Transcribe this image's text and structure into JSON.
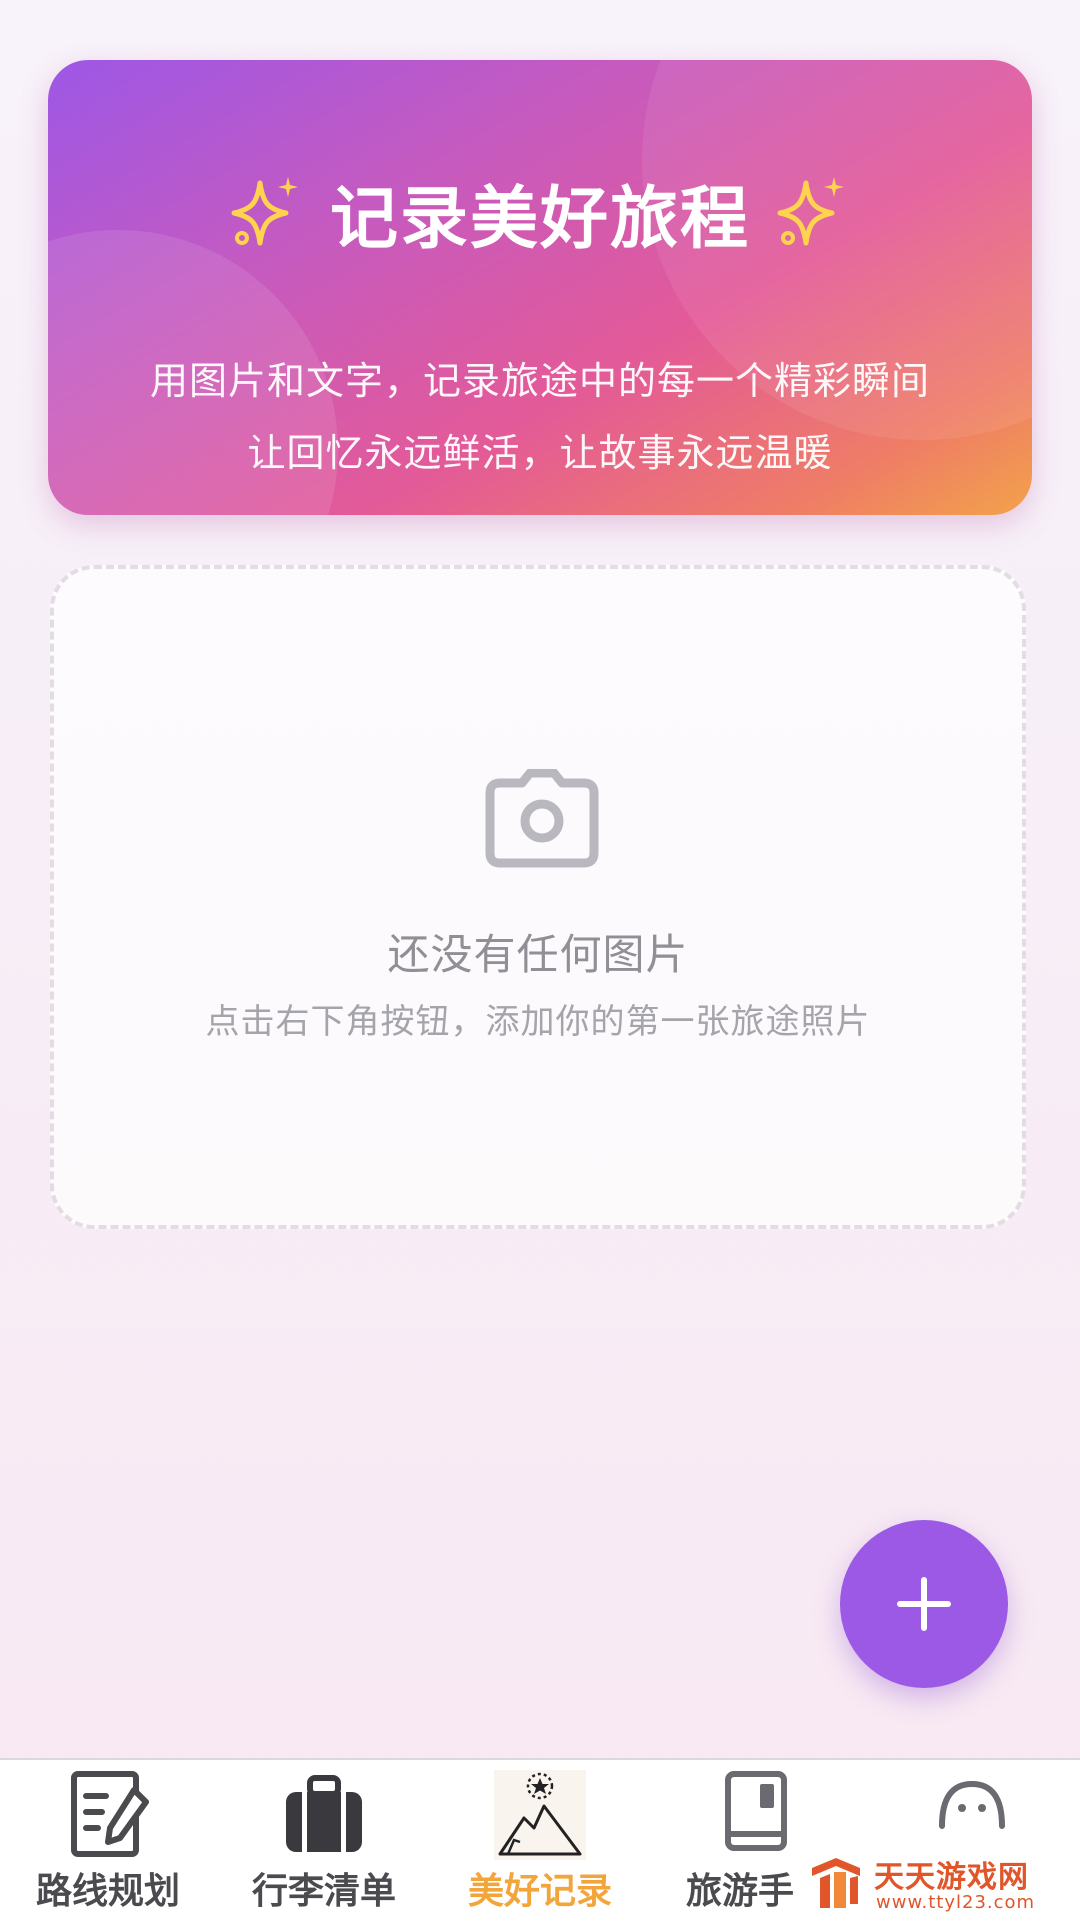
{
  "hero": {
    "title": "记录美好旅程",
    "subtitle_line1": "用图片和文字，记录旅途中的每一个精彩瞬间",
    "subtitle_line2": "让回忆永远鲜活，让故事永远温暖",
    "left_icon": "sparkle-icon",
    "right_icon": "sparkle-icon",
    "gradient_colors": [
      "#9d57e6",
      "#e35a98",
      "#f2a24a"
    ]
  },
  "empty_state": {
    "icon": "camera-icon",
    "title": "还没有任何图片",
    "hint": "点击右下角按钮，添加你的第一张旅途照片"
  },
  "fab": {
    "icon": "plus-icon",
    "color": "#9b59e6"
  },
  "tabbar": {
    "active_index": 2,
    "active_color": "#f2a53b",
    "tabs": [
      {
        "label": "路线规划",
        "icon": "route-plan-icon"
      },
      {
        "label": "行李清单",
        "icon": "luggage-icon"
      },
      {
        "label": "美好记录",
        "icon": "mountain-star-icon"
      },
      {
        "label": "旅游手",
        "icon": "guide-book-icon"
      },
      {
        "label": "",
        "icon": "chat-bot-icon"
      }
    ]
  },
  "watermark": {
    "text": "天天游戏网",
    "url": "www.ttyl23.com"
  }
}
